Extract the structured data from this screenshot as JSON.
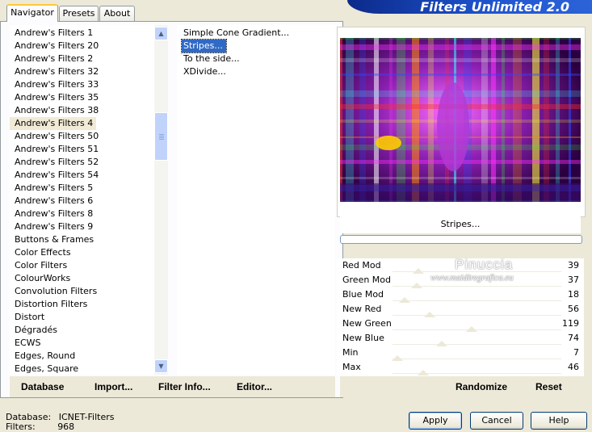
{
  "banner": {
    "title": "Filters Unlimited 2.0"
  },
  "tabs": [
    {
      "label": "Navigator",
      "active": true
    },
    {
      "label": "Presets",
      "active": false
    },
    {
      "label": "About",
      "active": false
    }
  ],
  "categories": {
    "items": [
      "Andrew's Filters 1",
      "Andrew's Filters 20",
      "Andrew's Filters 2",
      "Andrew's Filters 32",
      "Andrew's Filters 33",
      "Andrew's Filters 35",
      "Andrew's Filters 38",
      "Andrew's Filters 4",
      "Andrew's Filters 50",
      "Andrew's Filters 51",
      "Andrew's Filters 52",
      "Andrew's Filters 54",
      "Andrew's Filters 5",
      "Andrew's Filters 6",
      "Andrew's Filters 8",
      "Andrew's Filters 9",
      "Buttons & Frames",
      "Color Effects",
      "Color Filters",
      "ColourWorks",
      "Convolution Filters",
      "Distortion Filters",
      "Distort",
      "Dégradés",
      "ECWS",
      "Edges, Round",
      "Edges, Square"
    ],
    "selected": "Andrew's Filters 4"
  },
  "filters": {
    "items": [
      "Simple Cone Gradient...",
      "Stripes...",
      "To the side...",
      "XDivide..."
    ],
    "selected": "Stripes..."
  },
  "left_toolbar": {
    "database": "Database",
    "import": "Import...",
    "filter_info": "Filter Info...",
    "editor": "Editor..."
  },
  "preview": {
    "filter_name": "Stripes...",
    "progress": 0
  },
  "watermark": {
    "name": "Pinuccia",
    "url": "www.maidiregrafica.eu"
  },
  "sliders": [
    {
      "label": "Red Mod",
      "value": 39
    },
    {
      "label": "Green Mod",
      "value": 37
    },
    {
      "label": "Blue Mod",
      "value": 18
    },
    {
      "label": "New Red",
      "value": 56
    },
    {
      "label": "New Green",
      "value": 119
    },
    {
      "label": "New Blue",
      "value": 74
    },
    {
      "label": "Min",
      "value": 7
    },
    {
      "label": "Max",
      "value": 46
    }
  ],
  "right_toolbar": {
    "randomize": "Randomize",
    "reset": "Reset"
  },
  "buttons": {
    "apply": "Apply",
    "cancel": "Cancel",
    "help": "Help"
  },
  "status": {
    "database_label": "Database:",
    "database_value": "ICNET-Filters",
    "filters_label": "Filters:",
    "filters_value": "968"
  },
  "colors": {
    "banner": "#1f55d0",
    "selection": "#316ac5",
    "category_selection": "#f0ead6",
    "tab_highlight": "#ffc83c"
  }
}
